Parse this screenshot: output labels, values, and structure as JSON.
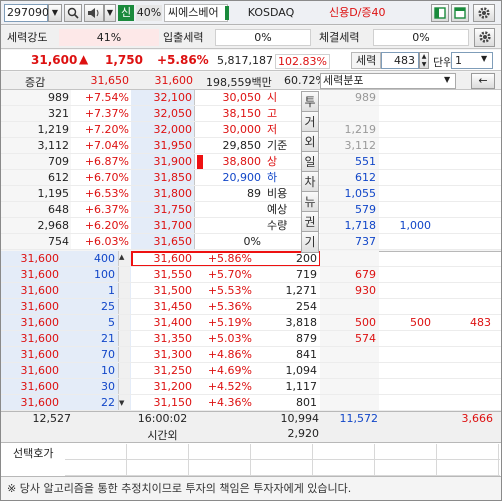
{
  "top": {
    "code": "297090",
    "credit_badge": "신",
    "margin_rate": "40%",
    "stock_name": "씨에스베어",
    "market": "KOSDAQ",
    "credit_info": "신용D/증40"
  },
  "strength_row": {
    "strength_label": "세력강도",
    "strength_value": "41%",
    "inout_label": "입출세력",
    "inout_value": "0%",
    "fill_label": "체결세력",
    "fill_value": "0%"
  },
  "price_row": {
    "price": "31,600",
    "arrow": "▲",
    "change": "1,750",
    "change_pct": "+5.86%",
    "volume": "5,817,187",
    "volume_ratio": "102.83%",
    "force_label": "세력",
    "force_count": "483",
    "unit_label": "단위",
    "unit_value": "1"
  },
  "header_row": {
    "label": "증감",
    "ask_total": "31,650",
    "bid_total": "31,600",
    "amount": "198,559백만",
    "ratio": "60.72%",
    "dist_label": "세력분포"
  },
  "ask_rows": [
    {
      "vol": "989",
      "pct": "+7.54%",
      "price": "32,100",
      "right": "989",
      "right2": ""
    },
    {
      "vol": "321",
      "pct": "+7.37%",
      "price": "32,050",
      "right": "",
      "right2": ""
    },
    {
      "vol": "1,219",
      "pct": "+7.20%",
      "price": "32,000",
      "right": "1,219",
      "right2": ""
    },
    {
      "vol": "3,112",
      "pct": "+7.04%",
      "price": "31,950",
      "right": "3,112",
      "right2": ""
    },
    {
      "vol": "709",
      "pct": "+6.87%",
      "price": "31,900",
      "right": "551",
      "right2": ""
    },
    {
      "vol": "612",
      "pct": "+6.70%",
      "price": "31,850",
      "right": "612",
      "right2": ""
    },
    {
      "vol": "1,195",
      "pct": "+6.53%",
      "price": "31,800",
      "right": "1,055",
      "right2": ""
    },
    {
      "vol": "648",
      "pct": "+6.37%",
      "price": "31,750",
      "right": "579",
      "right2": ""
    },
    {
      "vol": "2,968",
      "pct": "+6.20%",
      "price": "31,700",
      "right": "1,718",
      "right2": "1,000"
    },
    {
      "vol": "754",
      "pct": "+6.03%",
      "price": "31,650",
      "right": "737",
      "right2": ""
    }
  ],
  "info_panel": [
    {
      "value": "30,050",
      "label": "시"
    },
    {
      "value": "38,150",
      "label": "고"
    },
    {
      "value": "30,000",
      "label": "저"
    },
    {
      "value": "29,850",
      "label": "기준"
    },
    {
      "value": "38,800",
      "label": "상"
    },
    {
      "value": "20,900",
      "label": "하"
    },
    {
      "value": "89",
      "label": "비용"
    },
    {
      "value": "",
      "label": "예상"
    },
    {
      "value": "",
      "label": "수량"
    },
    {
      "value": "0%",
      "label": ""
    }
  ],
  "side_tabs": [
    "투",
    "거",
    "외",
    "일",
    "차",
    "뉴",
    "권",
    "기"
  ],
  "bid_rows": [
    {
      "p1": "31,600",
      "v1": "400",
      "price": "31,600",
      "pct": "+5.86%",
      "vol": "200",
      "c1": "",
      "c2": "",
      "c3": ""
    },
    {
      "p1": "31,600",
      "v1": "100",
      "price": "31,550",
      "pct": "+5.70%",
      "vol": "719",
      "c1": "679",
      "c2": "",
      "c3": ""
    },
    {
      "p1": "31,600",
      "v1": "1",
      "price": "31,500",
      "pct": "+5.53%",
      "vol": "1,271",
      "c1": "930",
      "c2": "",
      "c3": ""
    },
    {
      "p1": "31,600",
      "v1": "25",
      "price": "31,450",
      "pct": "+5.36%",
      "vol": "254",
      "c1": "",
      "c2": "",
      "c3": ""
    },
    {
      "p1": "31,600",
      "v1": "5",
      "price": "31,400",
      "pct": "+5.19%",
      "vol": "3,818",
      "c1": "500",
      "c2": "500",
      "c3": "483"
    },
    {
      "p1": "31,600",
      "v1": "21",
      "price": "31,350",
      "pct": "+5.03%",
      "vol": "879",
      "c1": "574",
      "c2": "",
      "c3": ""
    },
    {
      "p1": "31,600",
      "v1": "70",
      "price": "31,300",
      "pct": "+4.86%",
      "vol": "841",
      "c1": "",
      "c2": "",
      "c3": ""
    },
    {
      "p1": "31,600",
      "v1": "10",
      "price": "31,250",
      "pct": "+4.69%",
      "vol": "1,094",
      "c1": "",
      "c2": "",
      "c3": ""
    },
    {
      "p1": "31,600",
      "v1": "30",
      "price": "31,200",
      "pct": "+4.52%",
      "vol": "1,117",
      "c1": "",
      "c2": "",
      "c3": ""
    },
    {
      "p1": "31,600",
      "v1": "22",
      "price": "31,150",
      "pct": "+4.36%",
      "vol": "801",
      "c1": "",
      "c2": "",
      "c3": ""
    }
  ],
  "totals": {
    "ask_total": "12,527",
    "time": "16:00:02",
    "after_hours": "시간외",
    "bid_total": "10,994",
    "bid_after": "2,920",
    "c1": "11,572",
    "c3": "3,666"
  },
  "select_label": "선택호가",
  "footer_note": "※ 당사 알고리즘을 통한 추정치이므로 투자의 책임은 투자자에게 있습니다."
}
